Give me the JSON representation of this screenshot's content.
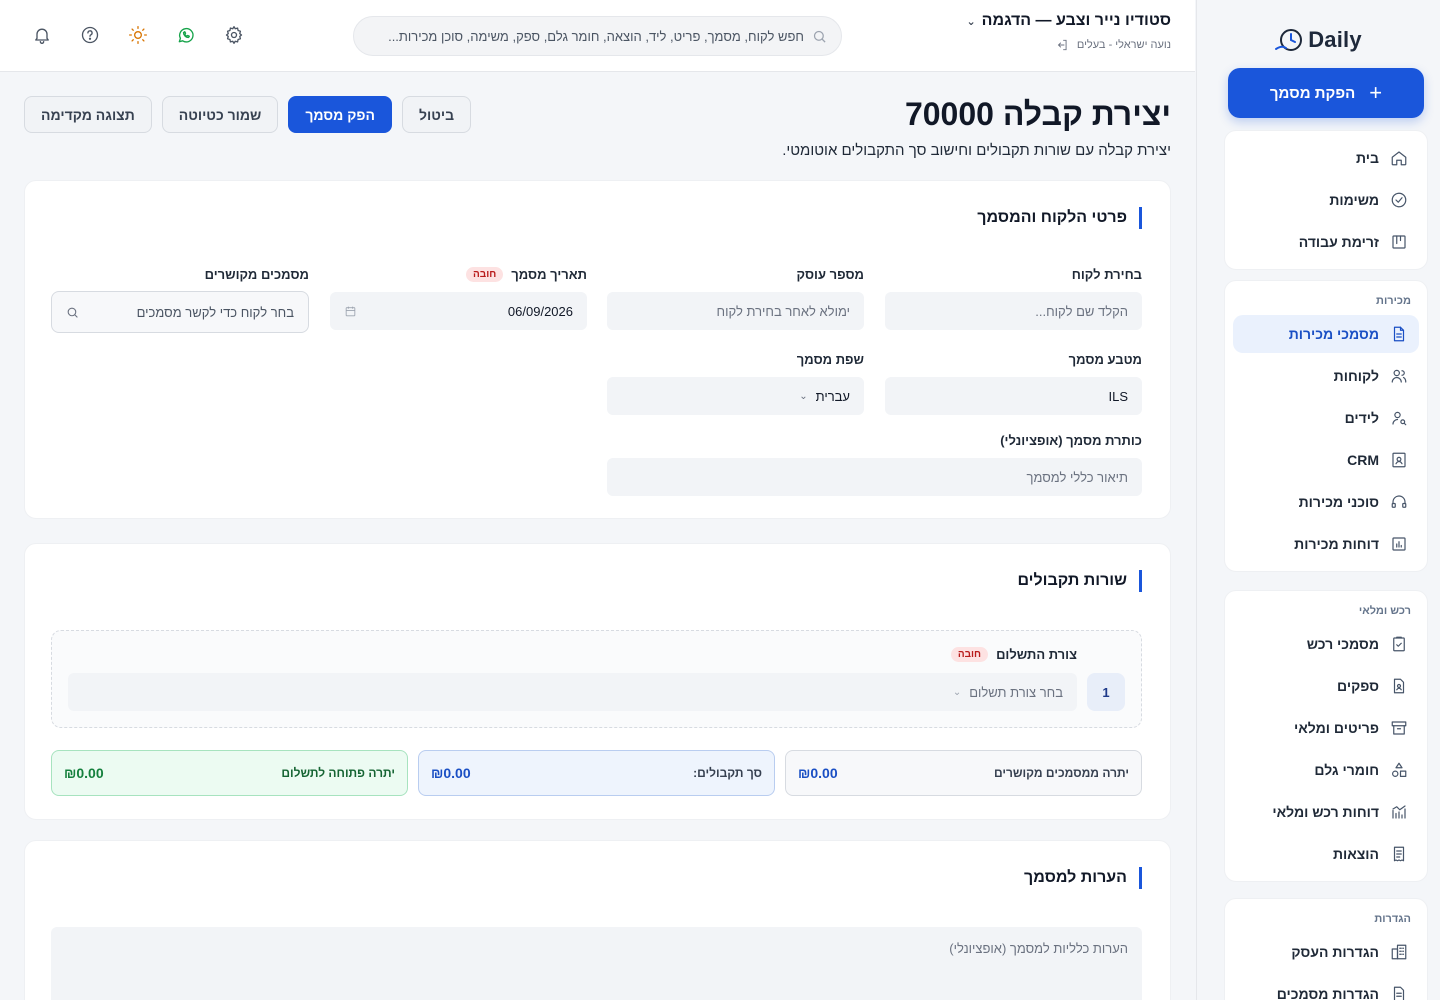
{
  "brand": {
    "logo_text": "Daily"
  },
  "sidebar": {
    "create_button": "הפקת מסמך",
    "main_items": [
      {
        "label": "בית",
        "icon": "home-icon"
      },
      {
        "label": "משימות",
        "icon": "check-circle-icon"
      },
      {
        "label": "זרימת עבודה",
        "icon": "kanban-icon"
      }
    ],
    "sales": {
      "title": "מכירות",
      "items": [
        {
          "label": "מסמכי מכירות",
          "icon": "document-icon",
          "active": true
        },
        {
          "label": "לקוחות",
          "icon": "users-icon"
        },
        {
          "label": "לידים",
          "icon": "user-search-icon"
        },
        {
          "label": "CRM",
          "icon": "contact-card-icon"
        },
        {
          "label": "סוכני מכירות",
          "icon": "headset-icon"
        },
        {
          "label": "דוחות מכירות",
          "icon": "bar-chart-icon"
        }
      ]
    },
    "procurement": {
      "title": "רכש ומלאי",
      "items": [
        {
          "label": "מסמכי רכש",
          "icon": "clipboard-check-icon"
        },
        {
          "label": "ספקים",
          "icon": "file-user-icon"
        },
        {
          "label": "פריטים ומלאי",
          "icon": "archive-icon"
        },
        {
          "label": "חומרי גלם",
          "icon": "shapes-icon"
        },
        {
          "label": "דוחות רכש ומלאי",
          "icon": "line-chart-icon"
        },
        {
          "label": "הוצאות",
          "icon": "receipt-icon"
        }
      ]
    },
    "settings": {
      "title": "הגדרות",
      "items": [
        {
          "label": "הגדרות העסק",
          "icon": "building-icon"
        },
        {
          "label": "הגדרות מסמכים",
          "icon": "file-settings-icon"
        }
      ]
    }
  },
  "topbar": {
    "business_name": "סטודיו נייר וצבע — הדגמה",
    "user_line": "נועה ישראלי - בעלים",
    "search_placeholder": "חפש לקוח, מסמך, פריט, ליד, הוצאה, חומר גלם, ספק, משימה, סוכן מכירות..."
  },
  "page": {
    "title": "יצירת קבלה 70000",
    "subtitle": "יצירת קבלה עם שורות תקבולים וחישוב סך התקבולים אוטומטי.",
    "actions": {
      "preview": "תצוגה מקדימה",
      "save_draft": "שמור כטיוטה",
      "issue": "הפק מסמך",
      "cancel": "ביטול"
    }
  },
  "customer_section": {
    "title": "פרטי הלקוח והמסמך",
    "customer_label": "בחירת לקוח",
    "customer_placeholder": "הקלד שם לקוח...",
    "dealer_label": "מספר עוסק",
    "dealer_placeholder": "ימולא לאחר בחירת לקוח",
    "date_label": "תאריך מסמך",
    "date_value": "06/09/2026",
    "required_badge": "חובה",
    "linked_label": "מסמכים מקושרים",
    "linked_placeholder": "בחר לקוח כדי לקשר מסמכים",
    "currency_label": "מטבע מסמך",
    "currency_value": "ILS",
    "language_label": "שפת מסמך",
    "language_value": "עברית",
    "doc_title_label": "כותרת מסמך (אופציונלי)",
    "doc_title_placeholder": "תיאור כללי למסמך"
  },
  "receipts_section": {
    "title": "שורות תקבולים",
    "row_number": "1",
    "payment_label": "צורת התשלום",
    "required_badge": "חובה",
    "payment_placeholder": "בחר צורת תשלום",
    "linked_balance_label": "יתרה ממסמכים מקושרים",
    "linked_balance_value": "₪0.00",
    "total_label": "סך תקבולים:",
    "total_value": "₪0.00",
    "open_balance_label": "יתרה פתוחה לתשלום",
    "open_balance_value": "₪0.00"
  },
  "notes_section": {
    "title": "הערות למסמך",
    "placeholder": "הערות כלליות למסמך (אופציונלי)"
  },
  "colors": {
    "primary": "#1a56db",
    "success": "#15803d",
    "danger": "#b91c1c"
  }
}
